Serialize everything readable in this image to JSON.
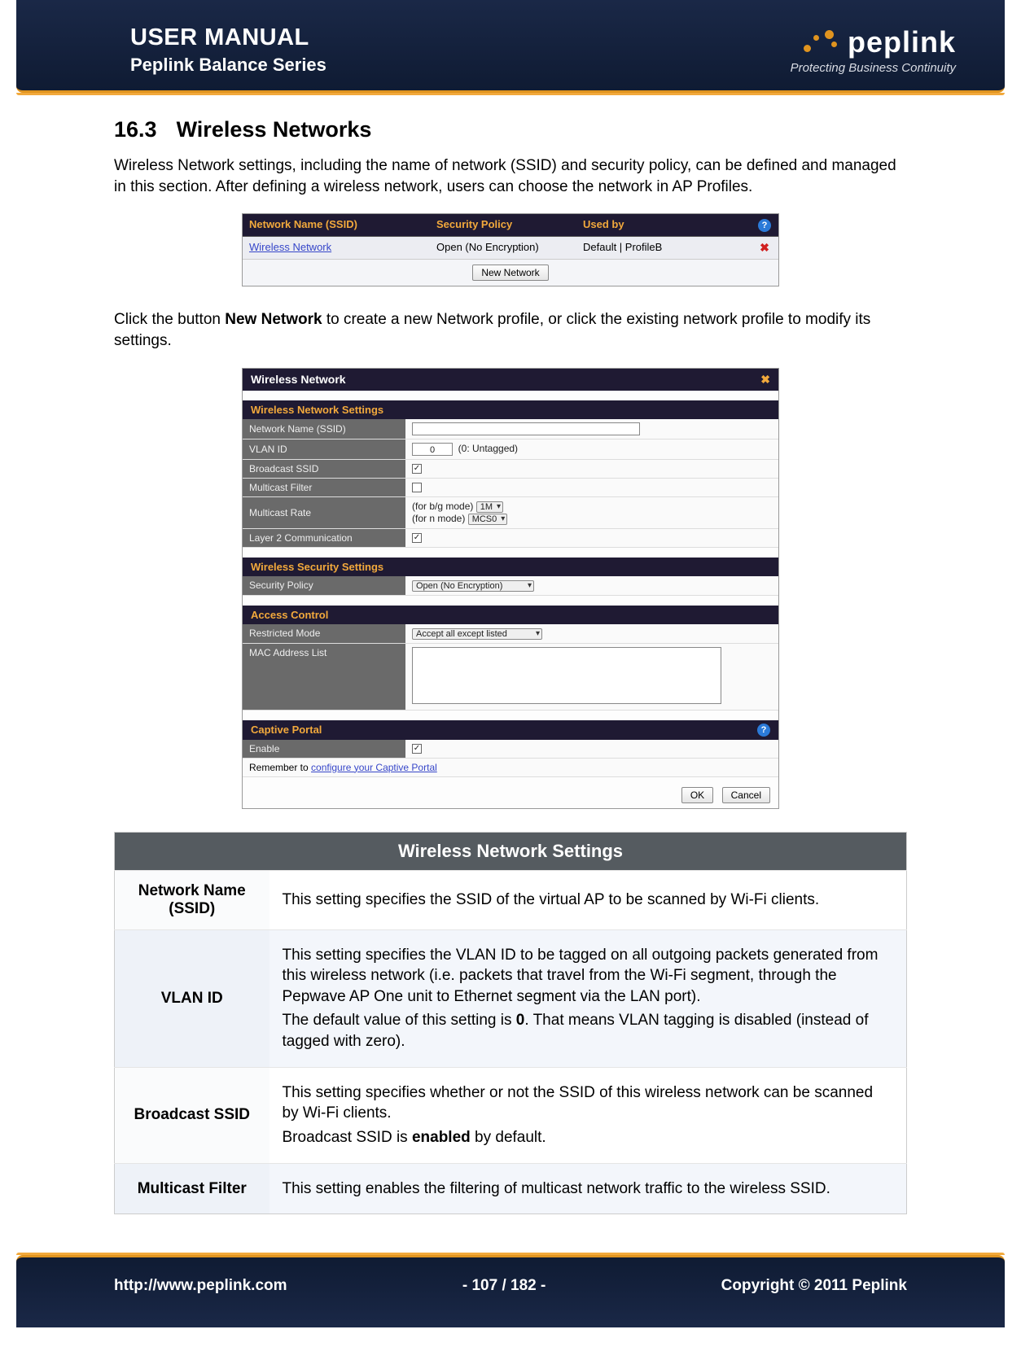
{
  "header": {
    "title": "USER MANUAL",
    "subtitle": "Peplink Balance Series",
    "brand_name": "peplink",
    "brand_tagline": "Protecting Business Continuity"
  },
  "section": {
    "number": "16.3",
    "title": "Wireless Networks",
    "intro": "Wireless Network settings, including the name of network (SSID) and security policy, can be defined and managed in this section. After defining a wireless network, users can choose the network in AP Profiles.",
    "click_prefix": "Click the button ",
    "click_bold": "New Network",
    "click_suffix": " to create a new Network profile, or click the existing network profile to modify its settings."
  },
  "list_fig": {
    "col1": "Network Name (SSID)",
    "col2": "Security Policy",
    "col3": "Used by",
    "row_name": "Wireless Network",
    "row_policy": "Open (No Encryption)",
    "row_used": "Default | ProfileB",
    "new_btn": "New Network"
  },
  "edit_fig": {
    "panel_title": "Wireless Network",
    "s1": "Wireless Network Settings",
    "f_ssid": "Network Name (SSID)",
    "f_vlan": "VLAN ID",
    "f_vlan_val": "0",
    "f_vlan_note": "(0: Untagged)",
    "f_bcast": "Broadcast SSID",
    "f_mfilter": "Multicast Filter",
    "f_mrate": "Multicast Rate",
    "f_mrate_bg_label": "(for b/g mode)",
    "f_mrate_bg_val": "1M",
    "f_mrate_n_label": "(for n mode)",
    "f_mrate_n_val": "MCS0",
    "f_l2": "Layer 2 Communication",
    "s2": "Wireless Security Settings",
    "f_secpol": "Security Policy",
    "f_secpol_val": "Open (No Encryption)",
    "s3": "Access Control",
    "f_rmode": "Restricted Mode",
    "f_rmode_val": "Accept all except listed",
    "f_maclist": "MAC Address List",
    "s4": "Captive Portal",
    "f_enable": "Enable",
    "f_remember_prefix": "Remember to ",
    "f_remember_link": "configure your Captive Portal",
    "btn_ok": "OK",
    "btn_cancel": "Cancel"
  },
  "settings_table": {
    "title": "Wireless Network Settings",
    "rows": [
      {
        "label": "Network Name (SSID)",
        "p1": "This setting specifies the SSID of the virtual AP to be scanned by Wi-Fi clients."
      },
      {
        "label": "VLAN ID",
        "p1": "This setting specifies the VLAN ID to be tagged on all outgoing packets generated from this wireless network (i.e. packets that travel from the Wi-Fi segment, through the Pepwave AP One unit to Ethernet segment via the LAN port).",
        "p2_a": "The default value of this setting is ",
        "p2_b": "0",
        "p2_c": ".  That means VLAN tagging is disabled (instead of tagged with zero)."
      },
      {
        "label": "Broadcast SSID",
        "p1": "This setting specifies whether or not the SSID of this wireless network can be scanned by Wi-Fi clients.",
        "p2_a": "Broadcast SSID is ",
        "p2_b": "enabled",
        "p2_c": " by default."
      },
      {
        "label": "Multicast Filter",
        "p1": "This setting enables the filtering of multicast network traffic to the wireless SSID."
      }
    ]
  },
  "footer": {
    "url": "http://www.peplink.com",
    "page": "- 107 / 182 -",
    "copyright": "Copyright © 2011 Peplink"
  }
}
